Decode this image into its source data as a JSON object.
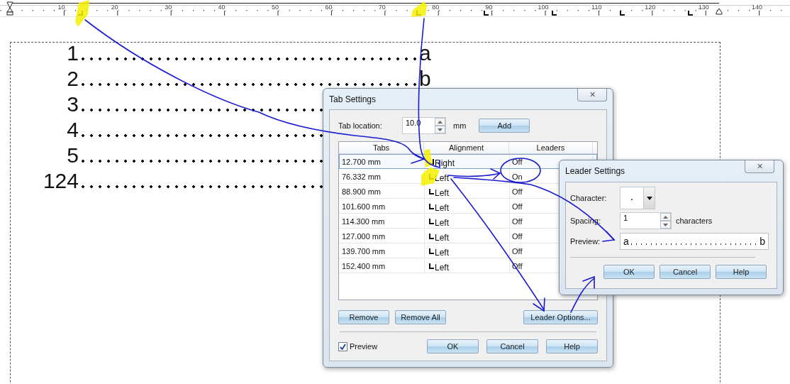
{
  "ruler": {
    "labels": [
      "10",
      "20",
      "30",
      "40",
      "50",
      "60",
      "70",
      "80",
      "90",
      "100",
      "110",
      "120",
      "130",
      "140"
    ]
  },
  "document": {
    "lines": [
      {
        "number": "1",
        "end": "a"
      },
      {
        "number": "2",
        "end": "b"
      },
      {
        "number": "3"
      },
      {
        "number": "4"
      },
      {
        "number": "5"
      },
      {
        "number": "124"
      }
    ]
  },
  "tab_settings": {
    "title": "Tab Settings",
    "close": "✕",
    "tab_location_label": "Tab location:",
    "tab_location": "10.0",
    "unit": "mm",
    "add": "Add",
    "columns": [
      "Tabs",
      "Alignment",
      "Leaders"
    ],
    "rows": [
      {
        "tab": "12.700 mm",
        "kind": "right",
        "alignment": "Right",
        "leaders": "Off",
        "selected": true
      },
      {
        "tab": "76.332 mm",
        "kind": "left",
        "alignment": "Left",
        "leaders": "On",
        "selected": false
      },
      {
        "tab": "88.900 mm",
        "kind": "left",
        "alignment": "Left",
        "leaders": "Off",
        "selected": false
      },
      {
        "tab": "101.600 mm",
        "kind": "left",
        "alignment": "Left",
        "leaders": "Off",
        "selected": false
      },
      {
        "tab": "114.300 mm",
        "kind": "left",
        "alignment": "Left",
        "leaders": "Off",
        "selected": false
      },
      {
        "tab": "127.000 mm",
        "kind": "left",
        "alignment": "Left",
        "leaders": "Off",
        "selected": false
      },
      {
        "tab": "139.700 mm",
        "kind": "left",
        "alignment": "Left",
        "leaders": "Off",
        "selected": false
      },
      {
        "tab": "152.400 mm",
        "kind": "left",
        "alignment": "Left",
        "leaders": "Off",
        "selected": false
      }
    ],
    "remove": "Remove",
    "remove_all": "Remove All",
    "leader_options": "Leader Options...",
    "preview": {
      "label": "Preview",
      "checked": true
    },
    "buttons": [
      "OK",
      "Cancel",
      "Help"
    ]
  },
  "leader_settings": {
    "title": "Leader Settings",
    "close": "✕",
    "character_label": "Character:",
    "character": ".",
    "spacing_label": "Spacing:",
    "spacing": "1",
    "spacing_unit": "characters",
    "preview_label": "Preview:",
    "preview_start": "a",
    "preview_end": "b",
    "buttons": [
      "OK",
      "Cancel",
      "Help"
    ]
  }
}
